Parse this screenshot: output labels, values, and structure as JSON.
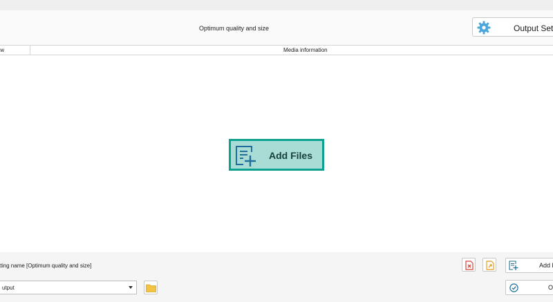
{
  "header": {
    "profile_label": "Optimum quality and size",
    "output_settings_label": "Output Setti"
  },
  "columns": {
    "preview": "iew",
    "media_information": "Media information"
  },
  "main": {
    "add_files_label": "Add Files"
  },
  "footer": {
    "setting_name": "etting name [Optimum quality and size]",
    "add_files_label": "Add F",
    "output_folder_value": "utput",
    "ok_label": "O"
  },
  "colors": {
    "accent_teal": "#0aa191",
    "accent_teal_fill": "#a8dcd4",
    "gear_blue": "#4aa6db",
    "remove_red": "#d9443b",
    "folder_yellow": "#f3c443"
  },
  "icons": {
    "gear": "gear-icon",
    "add_document": "add-document-icon",
    "remove_file": "remove-file-icon",
    "export_file": "export-file-icon",
    "folder": "folder-icon",
    "checkmark": "checkmark-circle-icon",
    "dropdown": "chevron-down-icon"
  }
}
